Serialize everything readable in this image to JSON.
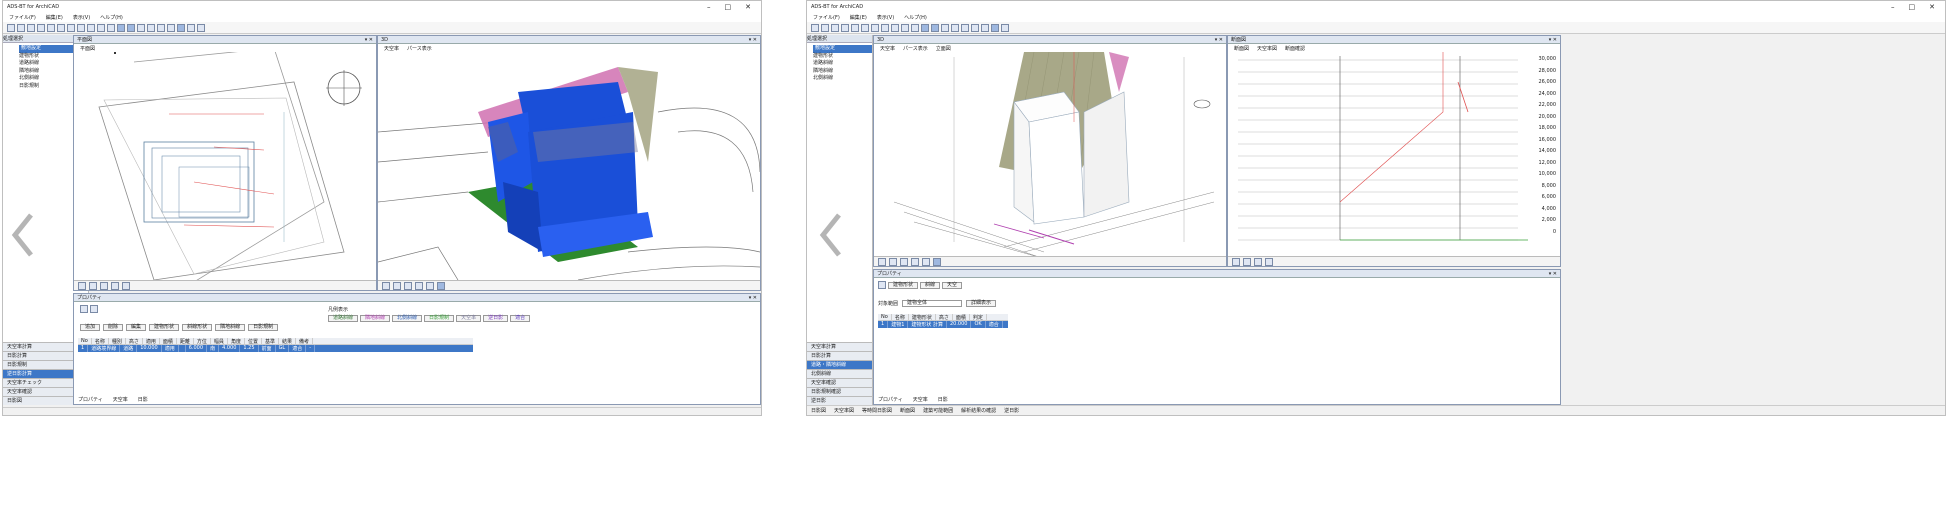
{
  "left_window": {
    "title": "ADS-BT for ArchiCAD",
    "menu": [
      "ファイル(F)",
      "編集(E)",
      "表示(V)",
      "ヘルプ(H)"
    ],
    "sidebar": {
      "header": "処理選択",
      "items": [
        "敷地設定",
        "建物形状",
        "道路斜線",
        "隣地斜線",
        "北側斜線",
        "日影規制"
      ],
      "selected_index": 0,
      "bottom_items": [
        "天空率計算",
        "日影計算",
        "日影規制",
        "逆日影計算",
        "天空率チェック",
        "天空率確認",
        "日影図"
      ],
      "bottom_selected_index": 3
    },
    "plan_pane": {
      "title": "平面図",
      "tabs": [
        "平面図"
      ]
    },
    "view3d_pane": {
      "title": "3D",
      "tabs": [
        "天空率",
        "パース表示"
      ]
    },
    "bottom_panel": {
      "title": "プロパティ",
      "buttons": [
        "追加",
        "削除",
        "編集",
        "建物形状",
        "斜線形状",
        "隣地斜線",
        "日影規制"
      ],
      "legend_title": "凡例表示",
      "legend": [
        {
          "label": "道路斜線",
          "color": "#3a7a3a"
        },
        {
          "label": "隣地斜線",
          "color": "#b040b0"
        },
        {
          "label": "北側斜線",
          "color": "#2a5ab0"
        },
        {
          "label": "日影規制",
          "color": "#3aa03a"
        },
        {
          "label": "天空率",
          "color": "#8080a0"
        },
        {
          "label": "逆日影",
          "color": "#8040c0"
        },
        {
          "label": "適合",
          "color": "#6040c0"
        }
      ],
      "columns": [
        "No",
        "名称",
        "種別",
        "高さ",
        "適用",
        "面積",
        "距離",
        "方位",
        "幅員",
        "角度",
        "位置",
        "基準",
        "結果",
        "備考"
      ],
      "row": [
        "1",
        "道路境界線",
        "道路",
        "10.000",
        "適用",
        "",
        "6.000",
        "南",
        "4.000",
        "1.25",
        "前面",
        "GL",
        "適合",
        "-"
      ],
      "tabs": [
        "プロパティ",
        "天空率",
        "日影"
      ]
    }
  },
  "right_window": {
    "title": "ADS-BT for ArchiCAD",
    "menu": [
      "ファイル(F)",
      "編集(E)",
      "表示(V)",
      "ヘルプ(H)"
    ],
    "sidebar": {
      "header": "処理選択",
      "items": [
        "敷地設定",
        "建物形状",
        "道路斜線",
        "隣地斜線",
        "北側斜線"
      ],
      "selected_index": 0,
      "bottom_items": [
        "天空率計算",
        "日影計算",
        "道路・隣地斜線",
        "北側斜線",
        "天空率確認",
        "日影規制確認",
        "逆日影"
      ],
      "bottom_selected_index": 2
    },
    "view3d_pane": {
      "title": "3D",
      "tabs": [
        "天空率",
        "パース表示",
        "立面図"
      ]
    },
    "section_pane": {
      "title": "断面図",
      "tabs": [
        "断面図",
        "天空率図",
        "断面確認"
      ],
      "height_labels": [
        "30,000",
        "28,000",
        "26,000",
        "24,000",
        "22,000",
        "20,000",
        "18,000",
        "16,000",
        "14,000",
        "12,000",
        "10,000",
        "8,000",
        "6,000",
        "4,000",
        "2,000",
        "0"
      ]
    },
    "bottom_panel": {
      "title": "プロパティ",
      "filter_label": "対象範囲",
      "filter_value": "建物全体",
      "button": "詳細表示",
      "tools": [
        "建物形状",
        "斜線",
        "天空"
      ],
      "columns": [
        "No",
        "名称",
        "建物形状",
        "高さ",
        "面積",
        "判定"
      ],
      "row": [
        "1",
        "建物1",
        "建物形状 計算",
        "20.000",
        "OK",
        "適合"
      ],
      "tabs": [
        "プロパティ",
        "天空率",
        "日影"
      ]
    },
    "status": [
      "日影図",
      "天空率図",
      "等時間日影図",
      "断面図",
      "建築可能範囲",
      "解析結果の確認",
      "逆日影"
    ]
  },
  "colors": {
    "accent": "#3d77c7",
    "building_blue": "#1a4fd8",
    "roof_pink": "#d070b0",
    "slope_olive": "#a8a888"
  }
}
